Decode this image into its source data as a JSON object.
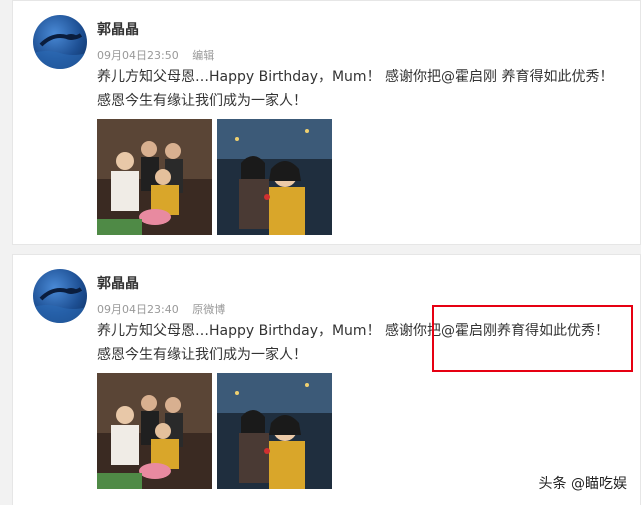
{
  "posts": [
    {
      "author": "郭晶晶",
      "time": "09月04日23:50",
      "action": "编辑",
      "content_line1_prefix": "养儿方知父母恩…Happy Birthday，Mum！ 感谢你把",
      "mention": "@霍启刚",
      "content_line1_suffix": " 养育得如此优秀！",
      "content_line2": "感恩今生有缘让我们成为一家人！"
    },
    {
      "author": "郭晶晶",
      "time": "09月04日23:40",
      "action": "原微博",
      "content_line1_prefix": "养儿方知父母恩…Happy Birthday，Mum！ 感谢你把",
      "mention": "@霍启刚",
      "content_line1_suffix": "养育得如此优秀！",
      "content_line2": "感恩今生有缘让我们成为一家人！"
    }
  ],
  "watermark": "头条 @瞄吃娱",
  "colors": {
    "highlight": "#e60012",
    "text": "#333333",
    "meta": "#999999"
  },
  "icons": {
    "avatar": "swimmer-avatar"
  }
}
